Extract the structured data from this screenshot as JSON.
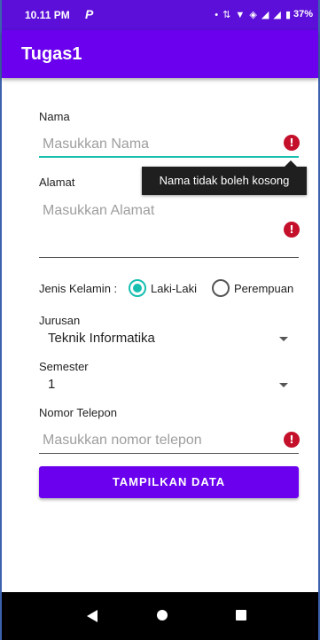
{
  "status_bar": {
    "time": "10.11 PM",
    "app_icon": "P",
    "icons": [
      "dot-icon",
      "data-arrows-icon",
      "wifi-icon",
      "volte-icon",
      "signal-icon",
      "signal-icon",
      "battery-icon"
    ],
    "battery": "37%"
  },
  "app_bar": {
    "title": "Tugas1"
  },
  "form": {
    "nama": {
      "label": "Nama",
      "placeholder": "Masukkan Nama",
      "error": "Nama tidak boleh kosong"
    },
    "alamat": {
      "label": "Alamat",
      "placeholder": "Masukkan Alamat"
    },
    "gender": {
      "label": "Jenis Kelamin :",
      "options": [
        "Laki-Laki",
        "Perempuan"
      ],
      "selected": "Laki-Laki"
    },
    "jurusan": {
      "label": "Jurusan",
      "value": "Teknik Informatika"
    },
    "semester": {
      "label": "Semester",
      "value": "1"
    },
    "telepon": {
      "label": "Nomor Telepon",
      "placeholder": "Masukkan nomor telepon"
    },
    "submit_label": "TAMPILKAN DATA"
  },
  "colors": {
    "status_bar": "#5b0fd9",
    "primary": "#6a00ee",
    "accent": "#17bfb0",
    "error": "#c4102b"
  }
}
